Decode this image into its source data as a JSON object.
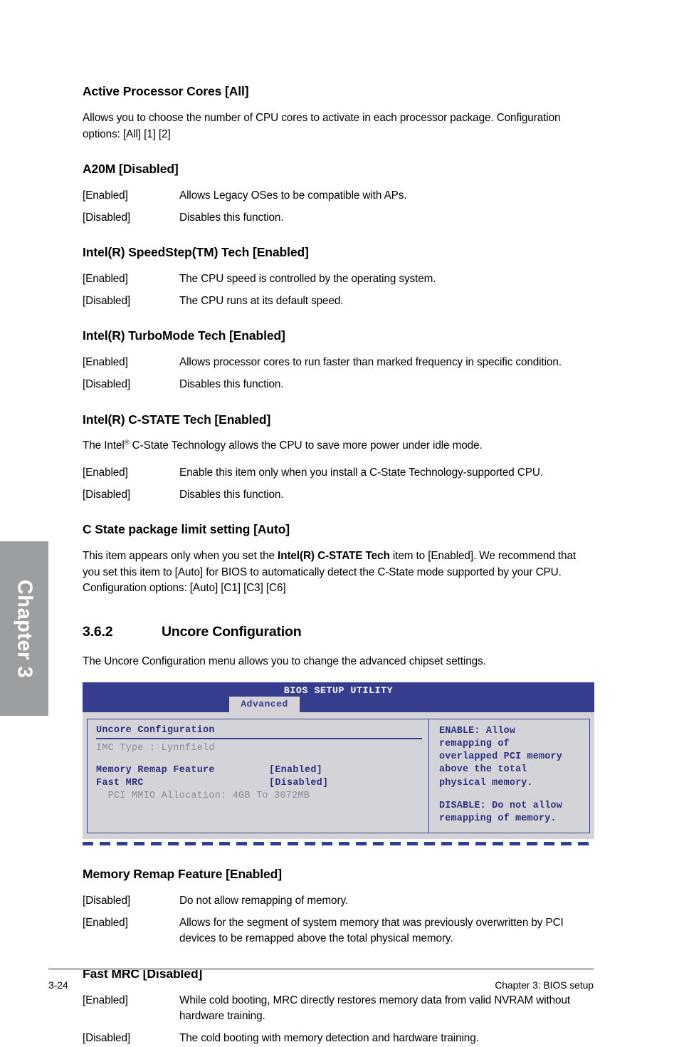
{
  "chapter_tab": {
    "label": "Chapter 3"
  },
  "sections": [
    {
      "id": "active-processor-cores",
      "heading": "Active Processor Cores [All]",
      "paragraphs": [
        "Allows you to choose the number of CPU cores to activate in each processor package. Configuration options: [All] [1] [2]"
      ],
      "options": []
    },
    {
      "id": "a20m",
      "heading": "A20M [Disabled]",
      "paragraphs": [],
      "options": [
        {
          "key": "[Enabled]",
          "desc": "Allows Legacy OSes to be compatible with APs."
        },
        {
          "key": "[Disabled]",
          "desc": "Disables this function."
        }
      ]
    },
    {
      "id": "speedstep",
      "heading": "Intel(R) SpeedStep(TM) Tech [Enabled]",
      "paragraphs": [],
      "options": [
        {
          "key": "[Enabled]",
          "desc": "The CPU speed is controlled by the operating system."
        },
        {
          "key": "[Disabled]",
          "desc": "The CPU runs at its default speed."
        }
      ]
    },
    {
      "id": "turbomode",
      "heading": "Intel(R) TurboMode Tech [Enabled]",
      "paragraphs": [],
      "options": [
        {
          "key": "[Enabled]",
          "desc": "Allows processor cores to run faster than marked frequency in specific condition."
        },
        {
          "key": "[Disabled]",
          "desc": "Disables this function."
        }
      ]
    },
    {
      "id": "c-state-tech",
      "heading": "Intel(R) C-STATE Tech [Enabled]",
      "intro_pre": "The Intel",
      "intro_sup": "®",
      "intro_post": " C-State Technology allows the CPU to save more power under idle mode.",
      "options": [
        {
          "key": "[Enabled]",
          "desc": "Enable this item only when you install a C-State Technology-supported CPU."
        },
        {
          "key": "[Disabled]",
          "desc": "Disables this function."
        }
      ]
    },
    {
      "id": "c-state-package-limit",
      "heading": "C State package limit setting [Auto]",
      "rich_paragraph": {
        "part1": "This item appears only when you set the ",
        "bold": "Intel(R) C-STATE Tech",
        "part2": " item to [Enabled]. We recommend that you set this item to [Auto] for BIOS to automatically detect the C-State mode supported by your CPU. Configuration options: [Auto] [C1] [C3] [C6]"
      }
    }
  ],
  "numbered_section": {
    "number": "3.6.2",
    "title": "Uncore Configuration",
    "intro": "The Uncore Configuration menu allows you to change the advanced chipset settings."
  },
  "bios_screen": {
    "title": "BIOS SETUP UTILITY",
    "active_tab": "Advanced",
    "section_title": "Uncore Configuration",
    "info_line": "IMC Type : Lynnfield",
    "items": [
      {
        "label": "Memory Remap Feature",
        "value": "[Enabled]"
      },
      {
        "label": "Fast MRC",
        "value": "[Disabled]"
      }
    ],
    "sub_line": "  PCI MMIO Allocation: 4GB To 3072MB",
    "help_text_1": "ENABLE: Allow\nremapping of\noverlapped PCI memory\nabove the total\nphysical memory.",
    "help_text_2": "DISABLE: Do not allow\nremapping of memory."
  },
  "bottom_sections": [
    {
      "id": "memory-remap-feature",
      "heading": "Memory Remap Feature [Enabled]",
      "options": [
        {
          "key": "[Disabled]",
          "desc": "Do not allow remapping of memory."
        },
        {
          "key": "[Enabled]",
          "desc": "Allows for the segment of system memory that was previously overwritten by PCI devices to be remapped above the total physical memory."
        }
      ]
    },
    {
      "id": "fast-mrc",
      "heading": "Fast MRC [Disabled]",
      "options": [
        {
          "key": "[Enabled]",
          "desc": "While cold booting, MRC directly restores memory data from valid NVRAM without hardware training."
        },
        {
          "key": "[Disabled]",
          "desc": "The cold booting with memory detection and hardware training."
        }
      ]
    }
  ],
  "footer": {
    "page_number": "3-24",
    "chapter_label": "Chapter 3: BIOS setup"
  }
}
